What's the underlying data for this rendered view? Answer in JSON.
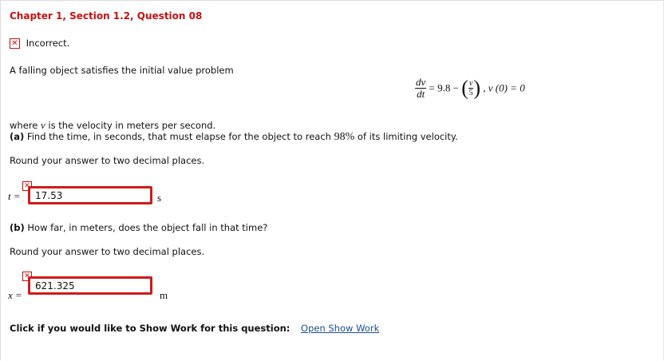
{
  "header": {
    "title": "Chapter 1, Section 1.2, Question 08"
  },
  "status": {
    "icon": "x-mark-icon",
    "text": "Incorrect."
  },
  "problem": {
    "intro": "A falling object satisfies the initial value problem",
    "equation": {
      "lhs_num": "dv",
      "lhs_den": "dt",
      "eq": "= 9.8 −",
      "frac_num": "v",
      "frac_den": "5",
      "ic": ", v (0) = 0"
    },
    "where_prefix": "where ",
    "where_var": "v",
    "where_suffix": " is the velocity in meters per second.",
    "part_a_label": "(a)",
    "part_a_text_1": " Find the time, in seconds, that must elapse for the object to reach ",
    "part_a_percent": "98%",
    "part_a_text_2": " of its limiting velocity.",
    "round_a": "Round your answer to two decimal places.",
    "part_b_label": "(b)",
    "part_b_text": " How far, in meters, does the object fall in that time?",
    "round_b": "Round your answer to two decimal places."
  },
  "answers": {
    "t": {
      "var": "t =",
      "value": "17.53",
      "unit": "s"
    },
    "x": {
      "var": "x =",
      "value": "621.325",
      "unit": "m"
    }
  },
  "footer": {
    "prompt": "Click if you would like to Show Work for this question:",
    "link": "Open Show Work"
  },
  "colors": {
    "error": "#c4120f",
    "link": "#1d4f8f"
  }
}
